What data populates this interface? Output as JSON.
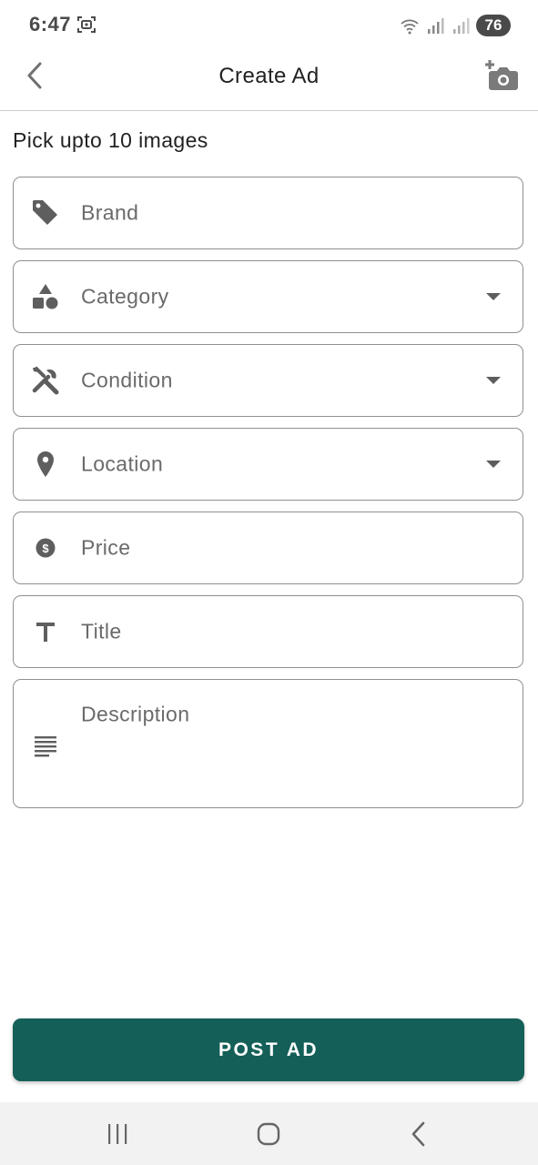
{
  "status_bar": {
    "time": "6:47",
    "battery": "76",
    "icons": [
      "screenshot-icon",
      "wifi-icon",
      "signal-icon",
      "signal-icon"
    ]
  },
  "app_bar": {
    "title": "Create Ad",
    "back_icon": "chevron-left-icon",
    "action_icon": "add-photo-icon"
  },
  "form": {
    "pick_label": "Pick upto 10 images",
    "fields": [
      {
        "label": "Brand",
        "icon": "tag-icon",
        "dropdown": false
      },
      {
        "label": "Category",
        "icon": "shapes-icon",
        "dropdown": true
      },
      {
        "label": "Condition",
        "icon": "tools-icon",
        "dropdown": true
      },
      {
        "label": "Location",
        "icon": "location-pin-icon",
        "dropdown": true
      },
      {
        "label": "Price",
        "icon": "dollar-coin-icon",
        "dropdown": false
      },
      {
        "label": "Title",
        "icon": "text-t-icon",
        "dropdown": false
      },
      {
        "label": "Description",
        "icon": "notes-lines-icon",
        "dropdown": false
      }
    ]
  },
  "post_button": {
    "label": "POST AD"
  },
  "colors": {
    "accent": "#145f58",
    "field_border": "#8f8f8f",
    "placeholder_text": "#6a6a6a",
    "icon": "#5e5e5e"
  }
}
